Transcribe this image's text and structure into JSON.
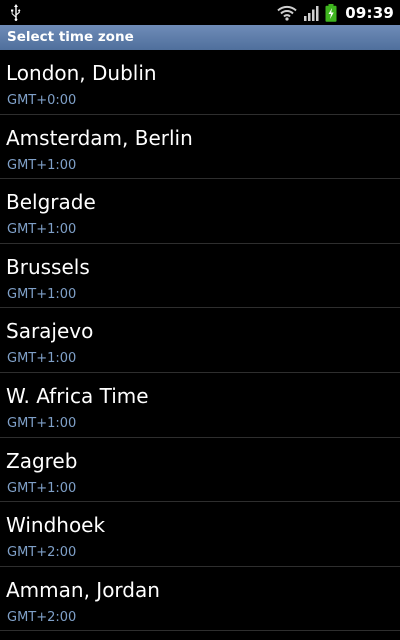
{
  "status_bar": {
    "time": "09:39",
    "icons": [
      "usb-icon",
      "wifi-icon",
      "signal-icon",
      "battery-charging-icon"
    ],
    "battery_color": "#3fb51f"
  },
  "title_bar": {
    "title": "Select time zone",
    "background": "#5b7aa8"
  },
  "timezones": [
    {
      "name": "London, Dublin",
      "offset": "GMT+0:00"
    },
    {
      "name": "Amsterdam, Berlin",
      "offset": "GMT+1:00"
    },
    {
      "name": "Belgrade",
      "offset": "GMT+1:00"
    },
    {
      "name": "Brussels",
      "offset": "GMT+1:00"
    },
    {
      "name": "Sarajevo",
      "offset": "GMT+1:00"
    },
    {
      "name": "W. Africa Time",
      "offset": "GMT+1:00"
    },
    {
      "name": "Zagreb",
      "offset": "GMT+1:00"
    },
    {
      "name": "Windhoek",
      "offset": "GMT+2:00"
    },
    {
      "name": "Amman, Jordan",
      "offset": "GMT+2:00"
    }
  ]
}
